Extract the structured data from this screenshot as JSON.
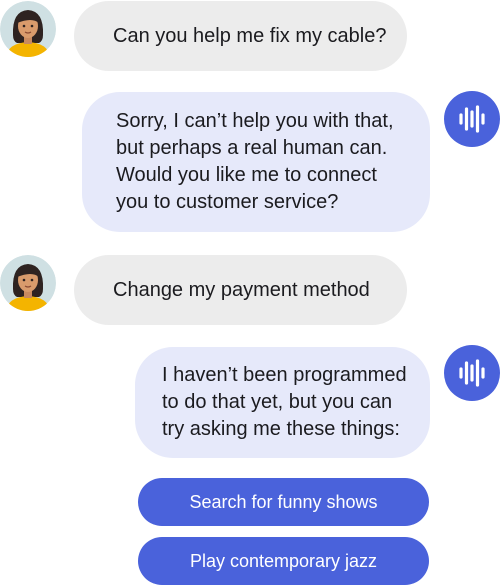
{
  "colors": {
    "accent": "#4a62db",
    "user_bubble": "#ececec",
    "bot_bubble": "#e6e9fa"
  },
  "messages": [
    {
      "sender": "user",
      "text": "Can you help me fix my cable?",
      "icon": "user-avatar"
    },
    {
      "sender": "bot",
      "lines": [
        "Sorry,  I can’t help you with that,",
        "but perhaps a real human can.",
        "Would you like me to connect",
        "you to customer service?"
      ],
      "icon": "voice-waveform-icon"
    },
    {
      "sender": "user",
      "text": "Change my payment method",
      "icon": "user-avatar"
    },
    {
      "sender": "bot",
      "lines": [
        "I haven’t been programmed",
        "to do that yet, but you can",
        "try asking me these things:"
      ],
      "icon": "voice-waveform-icon"
    }
  ],
  "suggestions": [
    "Search for funny shows",
    "Play contemporary jazz"
  ]
}
